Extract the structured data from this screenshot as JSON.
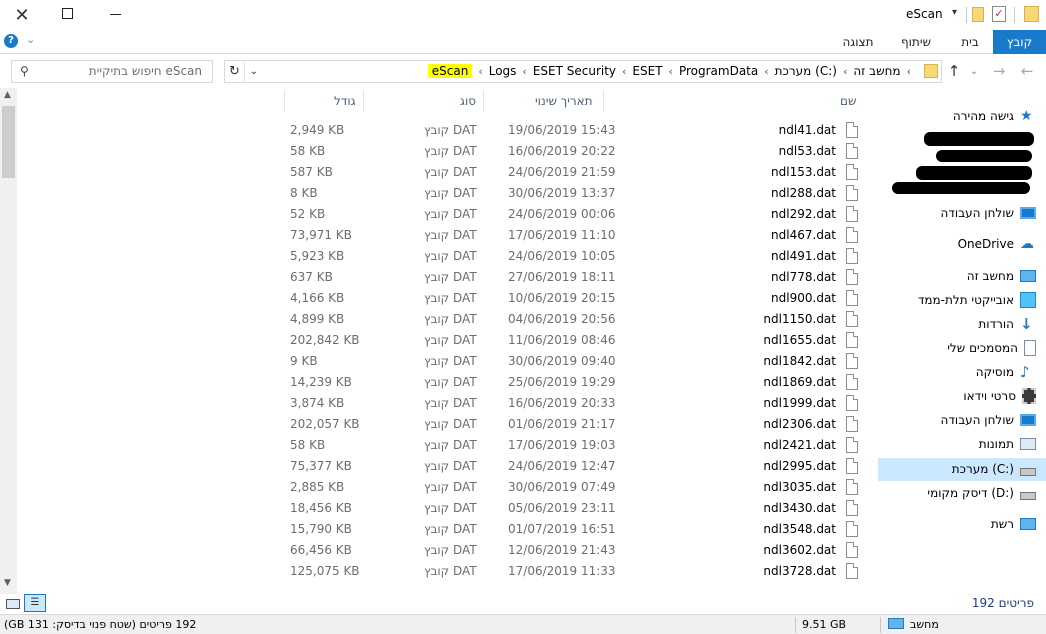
{
  "window": {
    "title": "eScan"
  },
  "ribbon": {
    "tabs": [
      "קובץ",
      "בית",
      "שיתוף",
      "תצוגה"
    ]
  },
  "address": {
    "crumbs": [
      "מחשב זה",
      "מערכת (C:)",
      "ProgramData",
      "ESET",
      "ESET Security",
      "Logs",
      "eScan"
    ]
  },
  "search": {
    "placeholder": "חיפוש בתיקיית eScan"
  },
  "columns": {
    "name": "שם",
    "date": "תאריך שינוי",
    "type": "סוג",
    "size": "גודל"
  },
  "files": [
    {
      "name": "ndl41.dat",
      "date": "19/06/2019 15:43",
      "type": "קובץ DAT",
      "size": "2,949 KB"
    },
    {
      "name": "ndl53.dat",
      "date": "16/06/2019 20:22",
      "type": "קובץ DAT",
      "size": "58 KB"
    },
    {
      "name": "ndl153.dat",
      "date": "24/06/2019 21:59",
      "type": "קובץ DAT",
      "size": "587 KB"
    },
    {
      "name": "ndl288.dat",
      "date": "30/06/2019 13:37",
      "type": "קובץ DAT",
      "size": "8 KB"
    },
    {
      "name": "ndl292.dat",
      "date": "24/06/2019 00:06",
      "type": "קובץ DAT",
      "size": "52 KB"
    },
    {
      "name": "ndl467.dat",
      "date": "17/06/2019 11:10",
      "type": "קובץ DAT",
      "size": "73,971 KB"
    },
    {
      "name": "ndl491.dat",
      "date": "24/06/2019 10:05",
      "type": "קובץ DAT",
      "size": "5,923 KB"
    },
    {
      "name": "ndl778.dat",
      "date": "27/06/2019 18:11",
      "type": "קובץ DAT",
      "size": "637 KB"
    },
    {
      "name": "ndl900.dat",
      "date": "10/06/2019 20:15",
      "type": "קובץ DAT",
      "size": "4,166 KB"
    },
    {
      "name": "ndl1150.dat",
      "date": "04/06/2019 20:56",
      "type": "קובץ DAT",
      "size": "4,899 KB"
    },
    {
      "name": "ndl1655.dat",
      "date": "11/06/2019 08:46",
      "type": "קובץ DAT",
      "size": "202,842 KB"
    },
    {
      "name": "ndl1842.dat",
      "date": "30/06/2019 09:40",
      "type": "קובץ DAT",
      "size": "9 KB"
    },
    {
      "name": "ndl1869.dat",
      "date": "25/06/2019 19:29",
      "type": "קובץ DAT",
      "size": "14,239 KB"
    },
    {
      "name": "ndl1999.dat",
      "date": "16/06/2019 20:33",
      "type": "קובץ DAT",
      "size": "3,874 KB"
    },
    {
      "name": "ndl2306.dat",
      "date": "01/06/2019 21:17",
      "type": "קובץ DAT",
      "size": "202,057 KB"
    },
    {
      "name": "ndl2421.dat",
      "date": "17/06/2019 19:03",
      "type": "קובץ DAT",
      "size": "58 KB"
    },
    {
      "name": "ndl2995.dat",
      "date": "24/06/2019 12:47",
      "type": "קובץ DAT",
      "size": "75,377 KB"
    },
    {
      "name": "ndl3035.dat",
      "date": "30/06/2019 07:49",
      "type": "קובץ DAT",
      "size": "2,885 KB"
    },
    {
      "name": "ndl3430.dat",
      "date": "05/06/2019 23:11",
      "type": "קובץ DAT",
      "size": "18,456 KB"
    },
    {
      "name": "ndl3548.dat",
      "date": "01/07/2019 16:51",
      "type": "קובץ DAT",
      "size": "15,790 KB"
    },
    {
      "name": "ndl3602.dat",
      "date": "12/06/2019 21:43",
      "type": "קובץ DAT",
      "size": "66,456 KB"
    },
    {
      "name": "ndl3728.dat",
      "date": "17/06/2019 11:33",
      "type": "קובץ DAT",
      "size": "125,075 KB"
    }
  ],
  "nav": {
    "quick": "גישה מהירה",
    "desktop": "שולחן העבודה",
    "onedrive": "OneDrive",
    "thispc": "מחשב זה",
    "objects3d": "אובייקטי תלת-ממד",
    "downloads": "הורדות",
    "documents": "המסמכים שלי",
    "music": "מוסיקה",
    "videos": "סרטי וידאו",
    "desktop2": "שולחן העבודה",
    "pictures": "תמונות",
    "cdrive": "מערכת (C:)",
    "ddrive": "דיסק מקומי (D:)",
    "network": "רשת"
  },
  "footer": {
    "items_count": "192 פריטים"
  },
  "status": {
    "left": "192 פריטים (שטח פנוי בדיסק: 131 GB)",
    "size": "9.51 GB",
    "location": "מחשב"
  },
  "colors": {
    "accent": "#1979ca",
    "highlight": "#ffff00",
    "selected": "#cce8ff"
  }
}
